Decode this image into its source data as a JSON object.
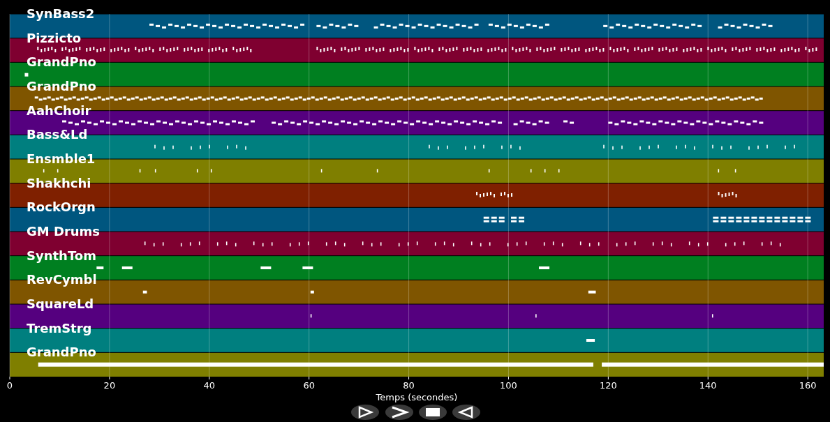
{
  "tracks": [
    {
      "name": "SynBass2",
      "color": "#00567f",
      "kind": "dash"
    },
    {
      "name": "Pizzicto",
      "color": "#7f0030",
      "kind": "tick"
    },
    {
      "name": "GrandPno",
      "color": "#007f20",
      "kind": "dot"
    },
    {
      "name": "GrandPno",
      "color": "#7f5500",
      "kind": "dense"
    },
    {
      "name": "AahChoir",
      "color": "#55007f",
      "kind": "dash"
    },
    {
      "name": "Bass&Ld",
      "color": "#007f7f",
      "kind": "sparse"
    },
    {
      "name": "Ensmble1",
      "color": "#7f7f00",
      "kind": "sparse"
    },
    {
      "name": "Shakhchi",
      "color": "#7f2000",
      "kind": "tick"
    },
    {
      "name": "RockOrgn",
      "color": "#00567f",
      "kind": "double"
    },
    {
      "name": "GM Drums",
      "color": "#7f0030",
      "kind": "sparse"
    },
    {
      "name": "SynthTom",
      "color": "#007f20",
      "kind": "bar"
    },
    {
      "name": "RevCymbl",
      "color": "#7f5500",
      "kind": "bar"
    },
    {
      "name": "SquareLd",
      "color": "#55007f",
      "kind": "sparse"
    },
    {
      "name": "TremStrg",
      "color": "#007f7f",
      "kind": "bar"
    },
    {
      "name": "GrandPno",
      "color": "#7f7f00",
      "kind": "thick"
    }
  ],
  "x_axis": {
    "ticks": [
      "0",
      "20",
      "40",
      "60",
      "80",
      "100",
      "120",
      "140",
      "160"
    ],
    "label": "Temps (secondes)"
  }
}
